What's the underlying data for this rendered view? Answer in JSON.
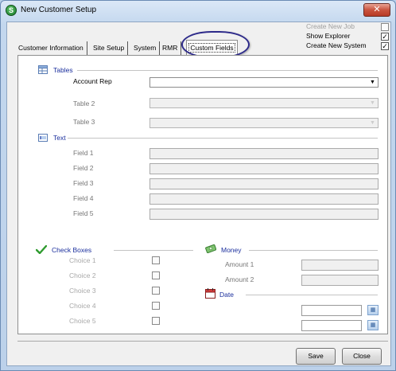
{
  "window": {
    "title": "New Customer Setup",
    "close_glyph": "✕",
    "app_icon": "S"
  },
  "options": {
    "create_new_job": {
      "label": "Create New Job",
      "checked": false,
      "enabled": false
    },
    "show_explorer": {
      "label": "Show Explorer",
      "checked": true,
      "enabled": true
    },
    "create_new_system": {
      "label": "Create New System",
      "checked": true,
      "enabled": true
    }
  },
  "tabs": [
    {
      "label": "Customer Information",
      "active": false
    },
    {
      "label": "Site Setup",
      "active": false
    },
    {
      "label": "System",
      "active": false
    },
    {
      "label": "RMR",
      "active": false
    },
    {
      "label": "Custom Fields",
      "active": true
    }
  ],
  "tables": {
    "title": "Tables",
    "icon": "table-icon",
    "fields": [
      {
        "label": "Account Rep",
        "value": "",
        "enabled": true
      },
      {
        "label": "Table 2",
        "value": "",
        "enabled": false
      },
      {
        "label": "Table 3",
        "value": "",
        "enabled": false
      }
    ]
  },
  "text": {
    "title": "Text",
    "icon": "textbox-icon",
    "fields": [
      {
        "label": "Field 1",
        "value": ""
      },
      {
        "label": "Field 2",
        "value": ""
      },
      {
        "label": "Field 3",
        "value": ""
      },
      {
        "label": "Field 4",
        "value": ""
      },
      {
        "label": "Field 5",
        "value": ""
      }
    ]
  },
  "check_boxes": {
    "title": "Check Boxes",
    "icon": "checkmark-icon",
    "items": [
      {
        "label": "Choice 1",
        "checked": false
      },
      {
        "label": "Choice 2",
        "checked": false
      },
      {
        "label": "Choice 3",
        "checked": false
      },
      {
        "label": "Choice 4",
        "checked": false
      },
      {
        "label": "Choice 5",
        "checked": false
      }
    ]
  },
  "money": {
    "title": "Money",
    "icon": "money-icon",
    "fields": [
      {
        "label": "Amount 1",
        "value": ""
      },
      {
        "label": "Amount 2",
        "value": ""
      }
    ]
  },
  "date": {
    "title": "Date",
    "icon": "calendar-icon",
    "fields": [
      {
        "value": ""
      },
      {
        "value": ""
      }
    ]
  },
  "buttons": {
    "save": "Save",
    "close": "Close"
  }
}
